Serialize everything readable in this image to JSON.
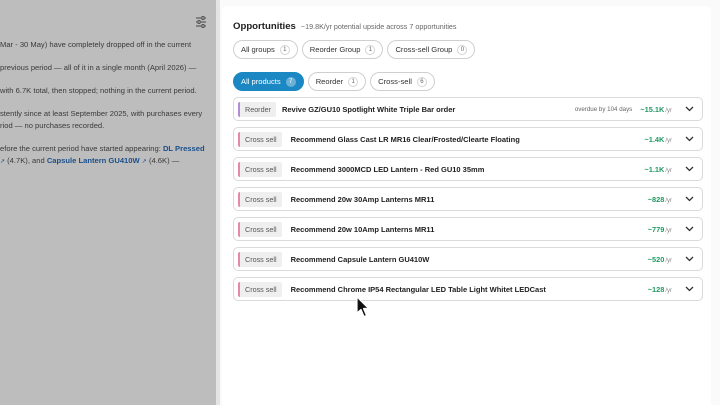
{
  "left_panel": {
    "settings_icon": "sliders-icon",
    "p1": "Mar - 30 May) have completely dropped off in the current",
    "p2": "previous period — all of it in a single month (April 2026) —",
    "p3": "with 6.7K total, then stopped; nothing in the current period.",
    "p4a": "stently since at least September 2025, with purchases every",
    "p4b": "riod — no purchases recorded.",
    "p5_prefix": "efore the current period have started appearing: ",
    "p5_link1": "DL Pressed",
    "p5_mid": " (4.7K), and ",
    "p5_link2": "Capsule Lantern GU410W",
    "p5_suffix": " (4.6K) —",
    "ext_glyph": "↗"
  },
  "header": {
    "title": "Opportunities",
    "subtitle": "~19.8K/yr potential upside across 7 opportunities"
  },
  "group_filters": [
    {
      "label": "All groups",
      "count": "1"
    },
    {
      "label": "Reorder Group",
      "count": "1"
    },
    {
      "label": "Cross-sell Group",
      "count": "0"
    }
  ],
  "tabs": [
    {
      "label": "All products",
      "count": "7",
      "active": true
    },
    {
      "label": "Reorder",
      "count": "1"
    },
    {
      "label": "Cross-sell",
      "count": "6"
    }
  ],
  "rows": [
    {
      "type": "Reorder",
      "title": "Revive GZ/GU10 Spotlight White Triple Bar order",
      "note": "overdue by 104 days",
      "value": "~15.1K",
      "unit": "/yr"
    },
    {
      "type": "Cross sell",
      "title": "Recommend Glass Cast LR MR16 Clear/Frosted/Clearte Floating",
      "note": "",
      "value": "~1.4K",
      "unit": "/yr"
    },
    {
      "type": "Cross sell",
      "title": "Recommend 3000MCD LED Lantern - Red GU10 35mm",
      "note": "",
      "value": "~1.1K",
      "unit": "/yr"
    },
    {
      "type": "Cross sell",
      "title": "Recommend 20w 30Amp Lanterns MR11",
      "note": "",
      "value": "~828",
      "unit": "/yr"
    },
    {
      "type": "Cross sell",
      "title": "Recommend 20w 10Amp Lanterns MR11",
      "note": "",
      "value": "~779",
      "unit": "/yr"
    },
    {
      "type": "Cross sell",
      "title": "Recommend Capsule Lantern GU410W",
      "note": "",
      "value": "~520",
      "unit": "/yr"
    },
    {
      "type": "Cross sell",
      "title": "Recommend Chrome IP54 Rectangular LED Table Light Whitet LEDCast",
      "note": "",
      "value": "~128",
      "unit": "/yr"
    }
  ],
  "colors": {
    "accent": "#1b88c4",
    "value_green": "#1f9a63",
    "crosssell_marker": "#e48aa7",
    "reorder_marker": "#b38bd6"
  }
}
